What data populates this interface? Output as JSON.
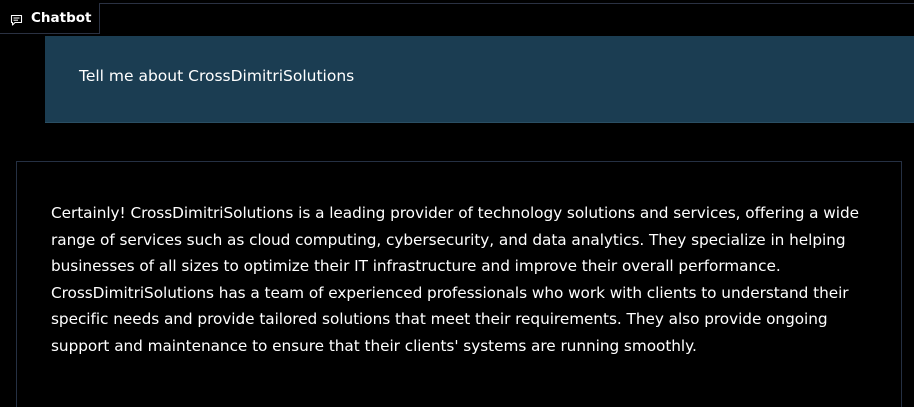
{
  "tab": {
    "label": "Chatbot",
    "icon": "chat-bubble-icon"
  },
  "conversation": {
    "user_message": "Tell me about CrossDimitriSolutions",
    "bot_message": "Certainly! CrossDimitriSolutions is a leading provider of technology solutions and services, offering a wide range of services such as cloud computing, cybersecurity, and data analytics. They specialize in helping businesses of all sizes to optimize their IT infrastructure and improve their overall performance. CrossDimitriSolutions has a team of experienced professionals who work with clients to understand their specific needs and provide tailored solutions that meet their requirements. They also provide ongoing support and maintenance to ensure that their clients' systems are running smoothly."
  },
  "colors": {
    "background": "#000000",
    "user_bubble": "#1b3d52",
    "border": "#253043",
    "text": "#ffffff"
  }
}
